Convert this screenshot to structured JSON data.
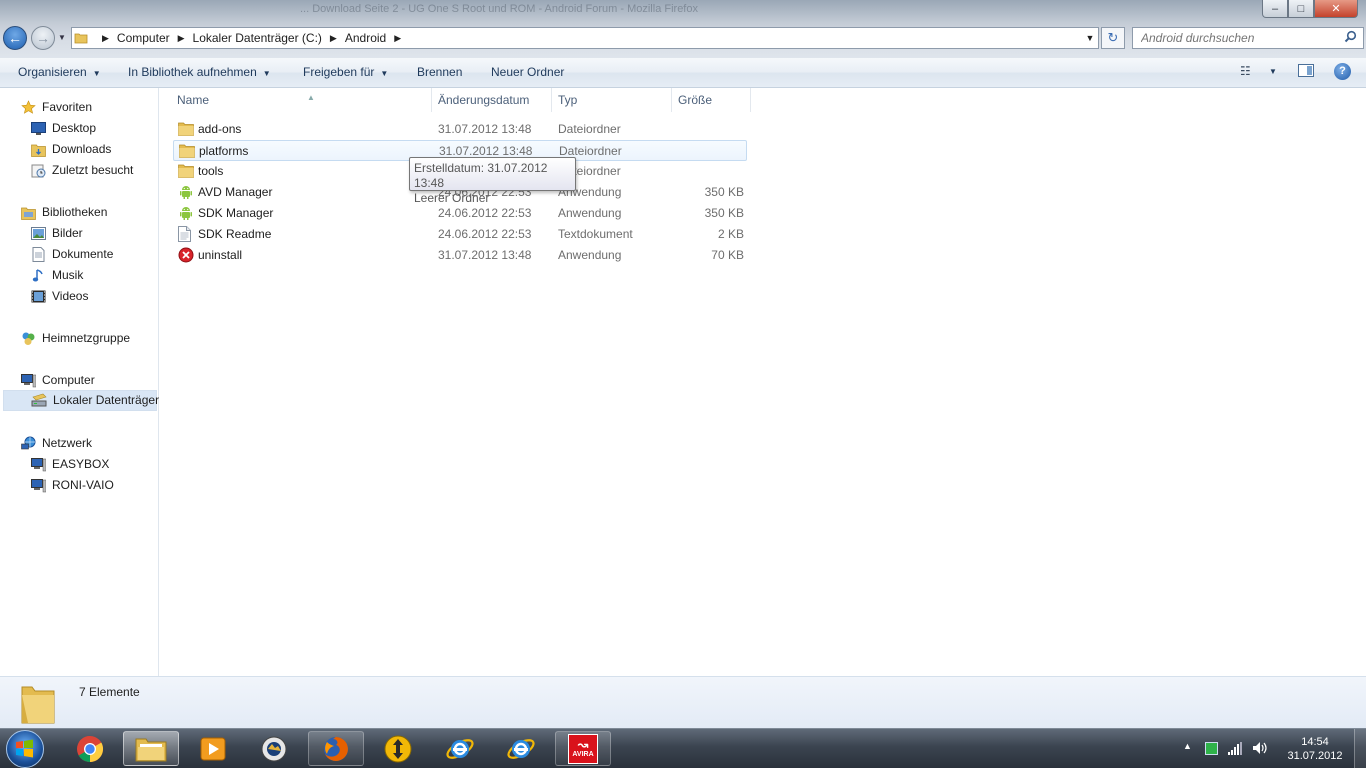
{
  "window": {
    "ghost_title": "... Download Seite 2 - UG One S Root und ROM - Android Forum - Mozilla Firefox",
    "controls": {
      "minimize": "–",
      "maximize": "□",
      "close": "✕"
    }
  },
  "address": {
    "crumbs": [
      "Computer",
      "Lokaler Datenträger (C:)",
      "Android"
    ],
    "search_placeholder": "Android durchsuchen"
  },
  "toolbar": {
    "organize": "Organisieren",
    "library": "In Bibliothek aufnehmen",
    "share": "Freigeben für",
    "burn": "Brennen",
    "new_folder": "Neuer Ordner"
  },
  "nav": {
    "favorites": "Favoriten",
    "desktop": "Desktop",
    "downloads": "Downloads",
    "recent": "Zuletzt besucht",
    "libraries": "Bibliotheken",
    "pictures": "Bilder",
    "documents": "Dokumente",
    "music": "Musik",
    "videos": "Videos",
    "homegroup": "Heimnetzgruppe",
    "computer": "Computer",
    "local_disk": "Lokaler Datenträger",
    "network": "Netzwerk",
    "easybox": "EASYBOX",
    "roni": "RONI-VAIO"
  },
  "columns": {
    "name": "Name",
    "date": "Änderungsdatum",
    "type": "Typ",
    "size": "Größe"
  },
  "files": [
    {
      "name": "add-ons",
      "date": "31.07.2012 13:48",
      "type": "Dateiordner",
      "size": "",
      "icon": "folder-icon"
    },
    {
      "name": "platforms",
      "date": "31.07.2012 13:48",
      "type": "Dateiordner",
      "size": "",
      "icon": "folder-icon"
    },
    {
      "name": "tools",
      "date": "31.07.2012 13:48",
      "type": "Dateiordner",
      "size": "",
      "icon": "folder-icon"
    },
    {
      "name": "AVD Manager",
      "date": "24.06.2012 22:53",
      "type": "Anwendung",
      "size": "350 KB",
      "icon": "android-icon"
    },
    {
      "name": "SDK Manager",
      "date": "24.06.2012 22:53",
      "type": "Anwendung",
      "size": "350 KB",
      "icon": "android-icon"
    },
    {
      "name": "SDK Readme",
      "date": "24.06.2012 22:53",
      "type": "Textdokument",
      "size": "2 KB",
      "icon": "text-file-icon"
    },
    {
      "name": "uninstall",
      "date": "31.07.2012 13:48",
      "type": "Anwendung",
      "size": "70 KB",
      "icon": "uninstall-icon"
    }
  ],
  "tooltip": {
    "line1": "Erstelldatum: 31.07.2012 13:48",
    "line2": "Leerer Ordner"
  },
  "status": {
    "count": "7 Elemente"
  },
  "taskbar": {
    "apps": [
      "chrome-icon",
      "explorer-icon",
      "media-player-icon",
      "photo-viewer-icon",
      "firefox-icon",
      "transfer-icon",
      "ie-icon",
      "ie-icon",
      "avira-icon"
    ],
    "avira_label": "AVIRA",
    "time": "14:54",
    "date": "31.07.2012"
  },
  "colors": {
    "accent": "#1f5aa8",
    "selection": "#d9e6f5",
    "hover_row": "#ecf4fd"
  }
}
